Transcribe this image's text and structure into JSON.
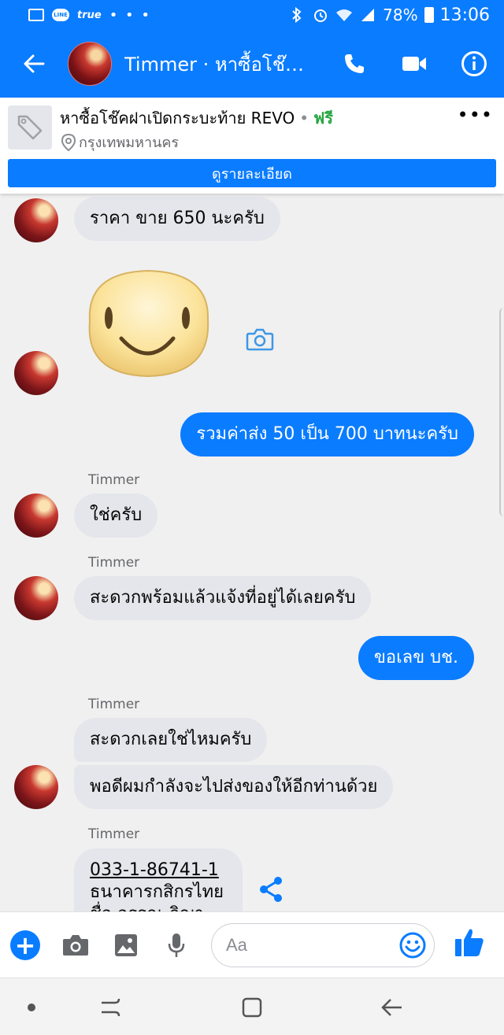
{
  "status_bar": {
    "carrier": "true",
    "overflow": "• • •",
    "battery": "78%",
    "time": "13:06",
    "icons": [
      "image-icon",
      "line-icon",
      "bluetooth-icon",
      "alarm-icon",
      "wifi-icon",
      "signal-icon",
      "battery-icon"
    ]
  },
  "header": {
    "title": "Timmer · หาซื้อโช๊…",
    "icons": [
      "back-arrow-icon",
      "phone-icon",
      "video-camera-icon",
      "info-icon"
    ]
  },
  "listing": {
    "title": "หาซื้อโช๊คฝาเปิดกระบะท้าย REVO",
    "separator": "•",
    "price": "ฟรี",
    "location": "กรุงเทพมหานคร",
    "details_button": "ดูรายละเอียด",
    "more": "•••"
  },
  "messages": {
    "m1": "ราคา ขาย 650 นะครับ",
    "m2": "รวมค่าส่ง 50 เป็น 700 บาทนะครับ",
    "sender1": "Timmer",
    "m3": "ใช่ครับ",
    "sender2": "Timmer",
    "m4": "สะดวกพร้อมแล้วแจ้งที่อยู่ได้เลยครับ",
    "m5": "ขอเลข บช.",
    "sender3": "Timmer",
    "m6": "สะดวกเลยใช่ไหมครับ",
    "m7": "พอดีผมกำลังจะไปส่งของให้อีกท่านด้วย",
    "sender4": "Timmer",
    "account_number": "033-1-86741-1",
    "bank_name": "ธนาคารกสิกรไทย",
    "account_name_partial": "ชื่อ อรรณ ภิญาวุฒิ"
  },
  "composer": {
    "placeholder": "Aa",
    "icons": [
      "plus-icon",
      "camera-icon",
      "gallery-icon",
      "microphone-icon",
      "emoji-icon",
      "like-icon"
    ]
  },
  "colors": {
    "messenger_blue": "#0a7cff",
    "incoming_bubble": "#e4e6eb",
    "chat_background": "#f0f0f0",
    "free_green": "#26a541"
  }
}
